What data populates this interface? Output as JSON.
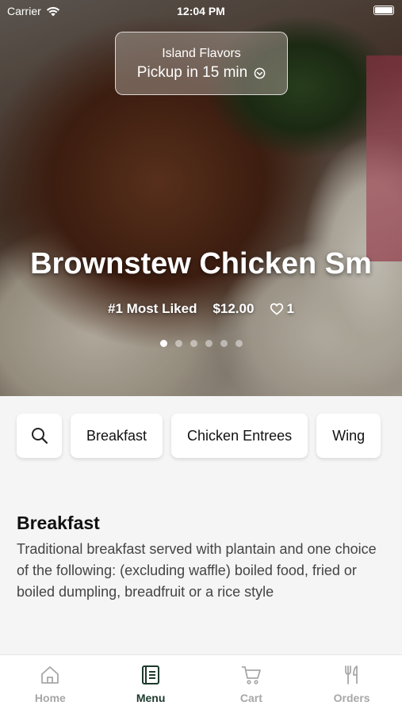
{
  "status_bar": {
    "carrier": "Carrier",
    "time": "12:04 PM"
  },
  "restaurant": {
    "name": "Island Flavors",
    "pickup": "Pickup in 15 min"
  },
  "featured": {
    "title": "Brownstew Chicken Sm",
    "badge": "#1 Most Liked",
    "price": "$12.00",
    "likes": "1",
    "slide_count": 6,
    "active_slide": 1
  },
  "categories": [
    "Breakfast",
    "Chicken Entrees",
    "Wing"
  ],
  "section": {
    "title": "Breakfast",
    "description": "Traditional breakfast served with plantain and one choice of the following: (excluding waffle) boiled food, fried or boiled dumpling, breadfruit or a rice style"
  },
  "tabs": [
    {
      "label": "Home",
      "icon": "home-icon"
    },
    {
      "label": "Menu",
      "icon": "menu-icon"
    },
    {
      "label": "Cart",
      "icon": "cart-icon"
    },
    {
      "label": "Orders",
      "icon": "fork-knife-icon"
    }
  ],
  "active_tab": "Menu",
  "colors": {
    "accent": "#1d3a2c",
    "inactive_tab": "#a7a7a7"
  }
}
